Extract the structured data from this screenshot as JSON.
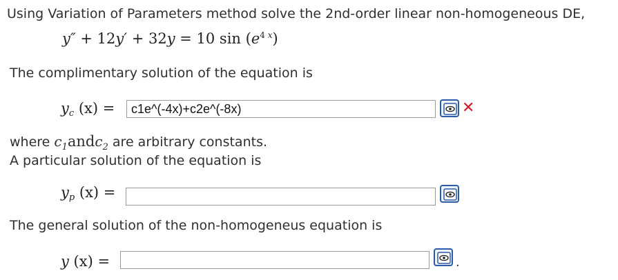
{
  "question": {
    "intro": "Using Variation of Parameters method solve the 2nd-order linear non-homogeneous DE,",
    "equation": {
      "y_dd": "y″",
      "plus1": " + 12",
      "y_d": "y′",
      "plus2": " + 32",
      "y": "y",
      "eq": " = 10",
      "sin": " sin ",
      "lp": "(",
      "e": "e",
      "exp4": "4",
      "expx": " x",
      "rp": ")"
    },
    "complementary_intro": "The complimentary solution of the equation is",
    "constants_where": "where ",
    "c1": "c",
    "c1_sub": "1",
    "and": "and",
    "c2": "c",
    "c2_sub": "2",
    "constants_rest": " are arbitrary constants.",
    "particular_intro": "A particular solution of the equation is",
    "general_intro": "The general solution of the non-homogeneus equation is",
    "trailing_period": "."
  },
  "fields": {
    "yc": {
      "label_y": "y",
      "label_sub": "c",
      "label_rest": " (x) =",
      "value": "c1e^(-4x)+c2e^(-8x)",
      "status": "incorrect",
      "status_mark": "✕"
    },
    "yp": {
      "label_y": "y",
      "label_sub": "p",
      "label_rest": " (x) =",
      "value": ""
    },
    "y": {
      "label_y": "y",
      "label_rest": " (x) =",
      "value": ""
    }
  },
  "icons": {
    "preview": "eye-preview-icon",
    "incorrect": "red-x-icon"
  },
  "colors": {
    "preview_border": "#2b5aa6",
    "incorrect": "#d11a2a"
  }
}
